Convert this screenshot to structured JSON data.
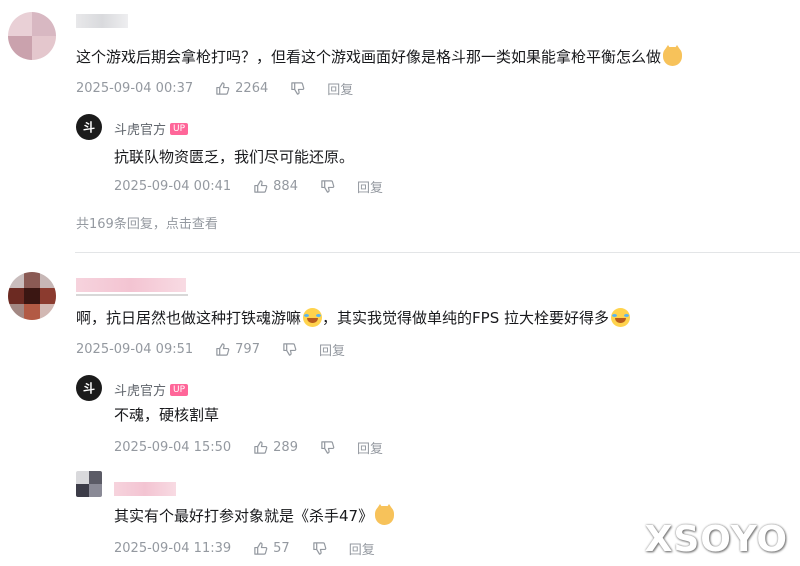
{
  "comments": [
    {
      "content": "这个游戏后期会拿枪打吗？，但看这个游戏画面好像是格斗那一类如果能拿枪平衡怎么做",
      "emoji": "cat",
      "time": "2025-09-04 00:37",
      "likes": "2264",
      "reply_label": "回复",
      "replies": [
        {
          "username": "斗虎官方",
          "badge": "UP",
          "avatar_char": "斗",
          "content": "抗联队物资匮乏，我们尽可能还原。",
          "time": "2025-09-04 00:41",
          "likes": "884",
          "reply_label": "回复"
        }
      ],
      "more_replies": "共169条回复，点击查看"
    },
    {
      "content": "啊，抗日居然也做这种打铁魂游嘛",
      "content_b": "，其实我觉得做单纯的FPS 拉大栓要好得多",
      "time": "2025-09-04 09:51",
      "likes": "797",
      "reply_label": "回复",
      "replies": [
        {
          "username": "斗虎官方",
          "badge": "UP",
          "avatar_char": "斗",
          "content": "不魂，硬核割草",
          "time": "2025-09-04 15:50",
          "likes": "289",
          "reply_label": "回复"
        },
        {
          "content": "其实有个最好打参对象就是《杀手47》",
          "emoji": "cat",
          "time": "2025-09-04 11:39",
          "likes": "57",
          "reply_label": "回复"
        }
      ]
    }
  ],
  "watermark": "XSOYO",
  "colors": {
    "meta": "#9499a0",
    "up_badge": "#ff6699",
    "divider": "#e3e5e7"
  }
}
